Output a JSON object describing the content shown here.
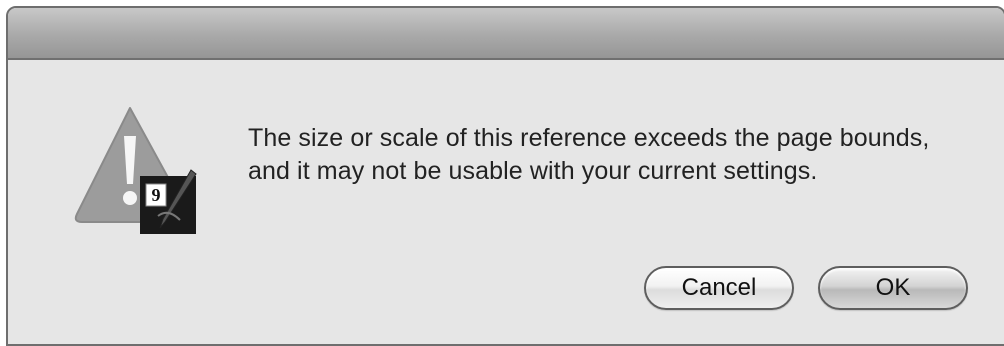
{
  "dialog": {
    "message": "The size or scale of this reference exceeds the page bounds, and it may not be usable with your current settings.",
    "icon": "warning-triangle-icon",
    "app_badge_icon": "app-badge-icon",
    "app_badge_glyph": "9"
  },
  "buttons": {
    "cancel_label": "Cancel",
    "ok_label": "OK"
  },
  "colors": {
    "window_bg": "#e6e6e6",
    "titlebar": "#a9a9a9",
    "warning_triangle": "#9c9c9c"
  }
}
